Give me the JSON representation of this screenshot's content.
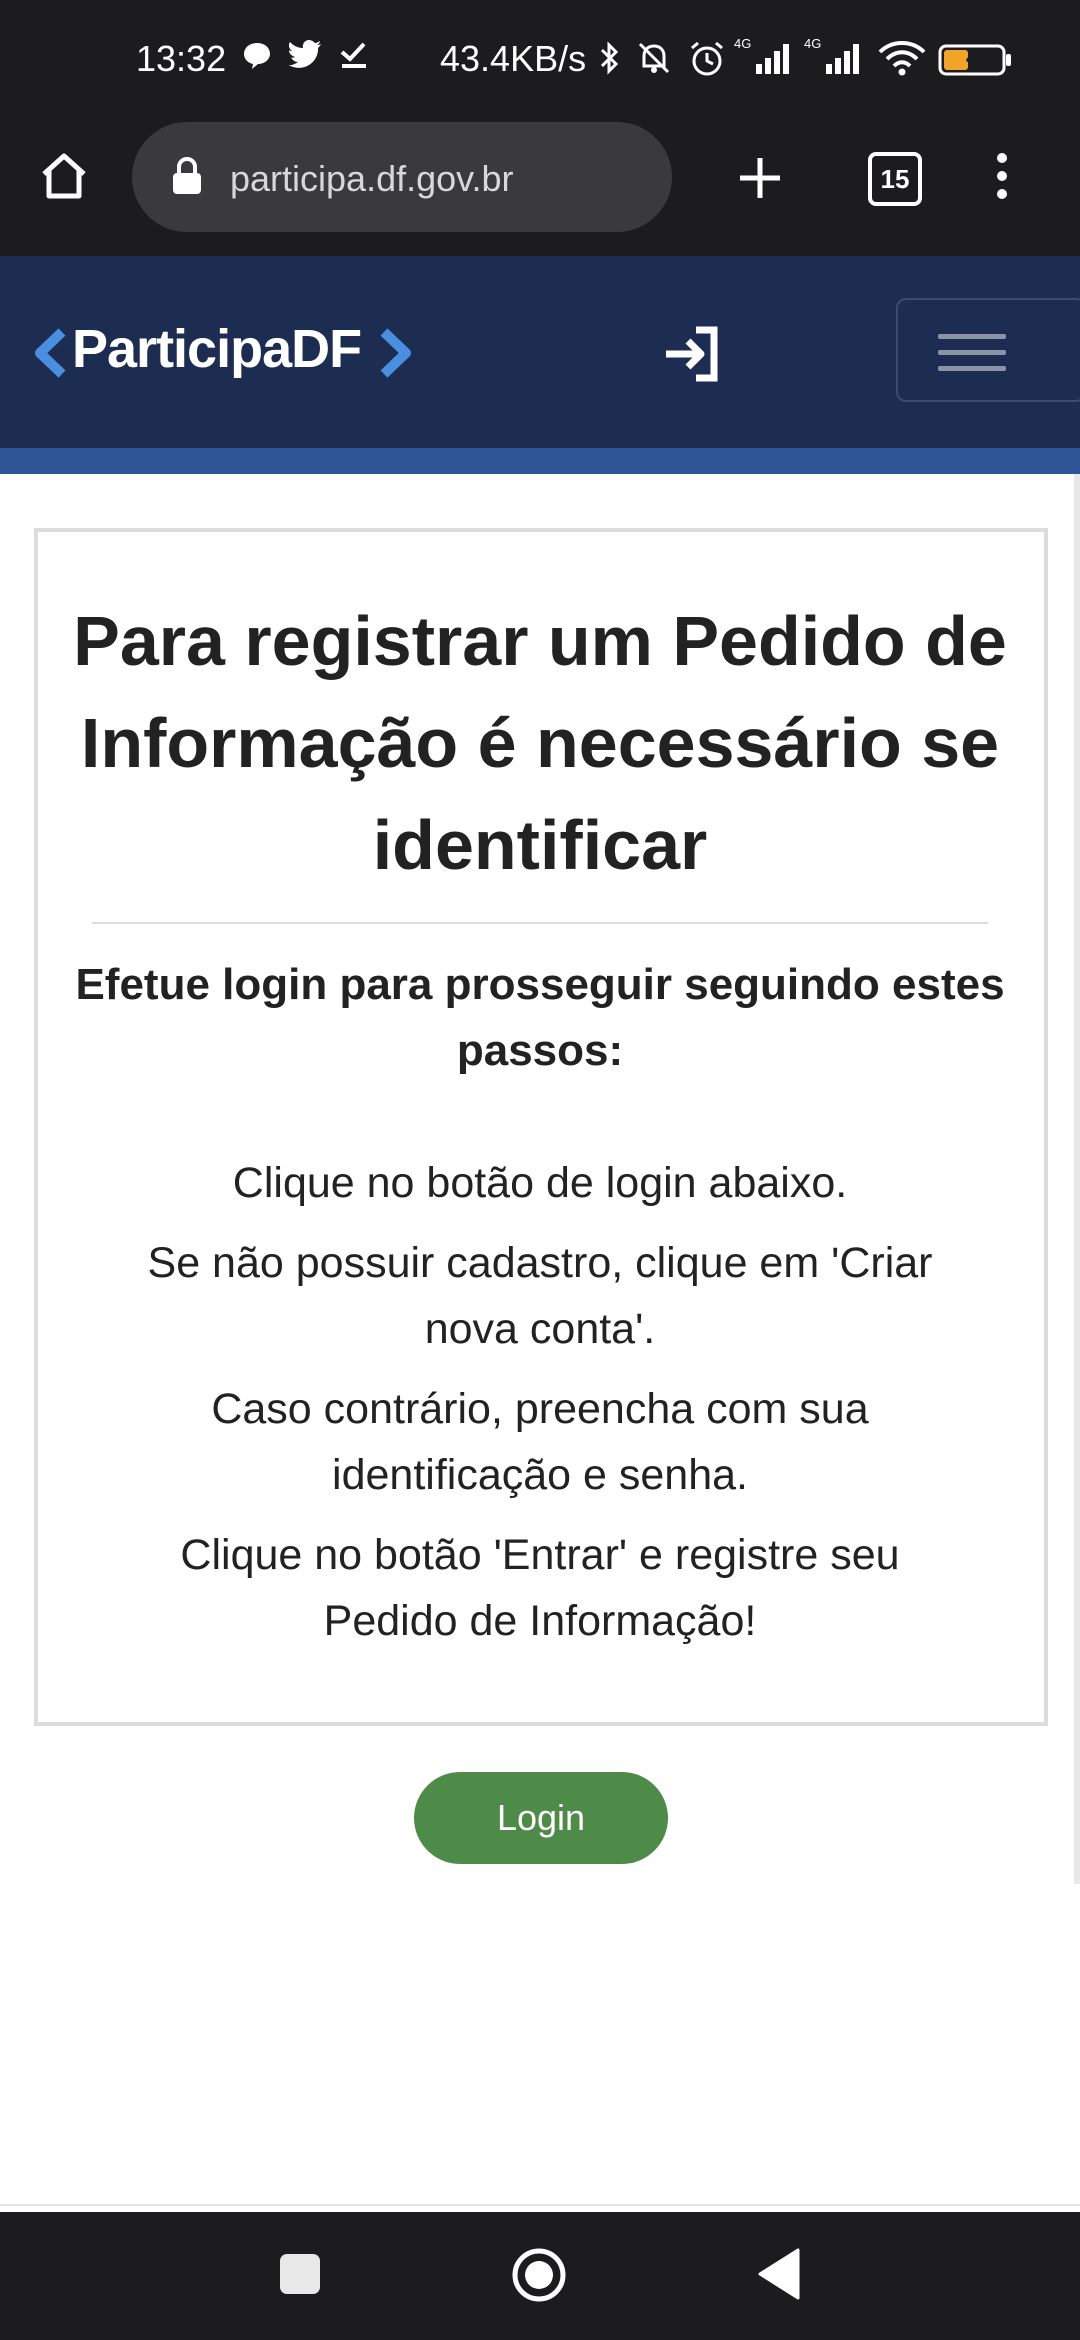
{
  "status_bar": {
    "time": "13:32",
    "network_speed": "43.4KB/s",
    "battery_level": "41",
    "icons": [
      "chat-bubble-icon",
      "twitter-icon",
      "check-icon",
      "bluetooth-icon",
      "bell-off-icon",
      "alarm-icon",
      "signal-4g-icon",
      "signal-4g-icon",
      "wifi-icon",
      "battery-icon"
    ]
  },
  "browser": {
    "url": "participa.df.gov.br",
    "tab_count": "15"
  },
  "header": {
    "logo_text": "ParticipaDF",
    "accent_color": "#1d2d52",
    "stripe_color": "#2f5596"
  },
  "card": {
    "title": "Para registrar um Pedido de Informação é necessário se identificar",
    "subtitle": "Efetue login para prosseguir seguindo estes passos:",
    "steps": [
      "Clique no botão de login abaixo.",
      "Se não possuir cadastro, clique em 'Criar nova conta'.",
      "Caso contrário, preencha com sua identificação e senha.",
      "Clique no botão 'Entrar' e registre seu Pedido de Informação!"
    ]
  },
  "login_button": {
    "label": "Login",
    "color": "#4e8b48"
  }
}
